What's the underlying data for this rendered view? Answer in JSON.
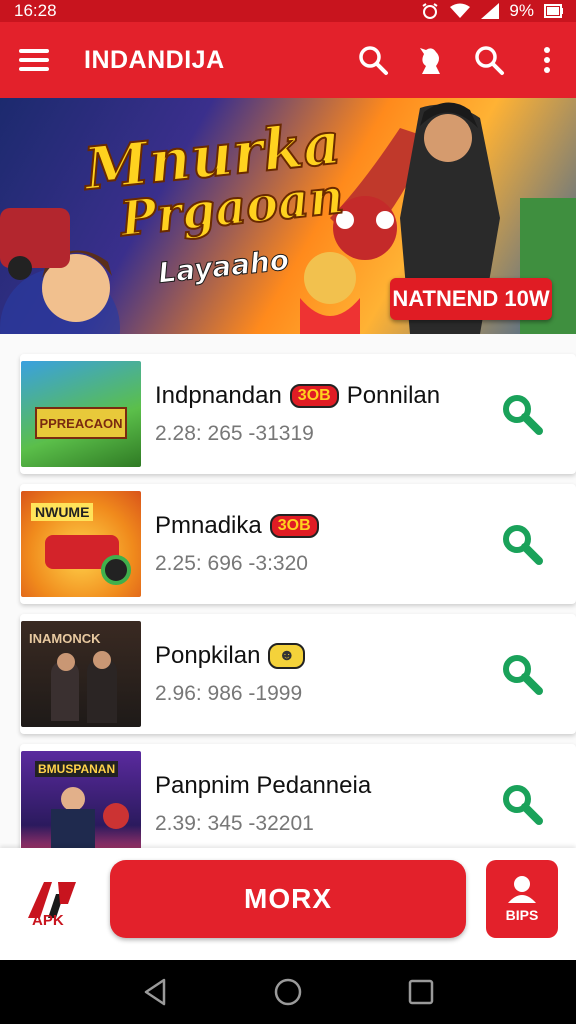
{
  "status": {
    "time": "16:28",
    "battery": "9%"
  },
  "appbar": {
    "title": "INDANDIJA"
  },
  "banner": {
    "title_line1": "Mnurka",
    "title_line2": "Prgaoan",
    "subtitle": "Layaaho",
    "cta": "NATNEND 10W"
  },
  "items": [
    {
      "title": "Indpnandan",
      "badge": "3OB",
      "title_suffix": "Ponnilan",
      "subtitle": "2.28: 265 -31319",
      "thumb_text": "PPREACAON"
    },
    {
      "title": "Pmnadika",
      "badge": "3OB",
      "title_suffix": "",
      "subtitle": "2.25: 696 -3:320",
      "thumb_text": "NWUME"
    },
    {
      "title": "Ponpkilan",
      "badge": "",
      "title_suffix": "",
      "subtitle": "2.96: 986 -1999",
      "thumb_text": "INAMONCK"
    },
    {
      "title": "Panpnim Pedanneia",
      "badge": "",
      "title_suffix": "",
      "subtitle": "2.39: 345 -32201",
      "thumb_text": "BMUSPANAN"
    }
  ],
  "bottom": {
    "logo_label": "APK",
    "more_label": "MORX",
    "tips_label": "BIPS"
  },
  "colors": {
    "brand_red": "#e3212b",
    "search_green": "#1aa25a"
  }
}
